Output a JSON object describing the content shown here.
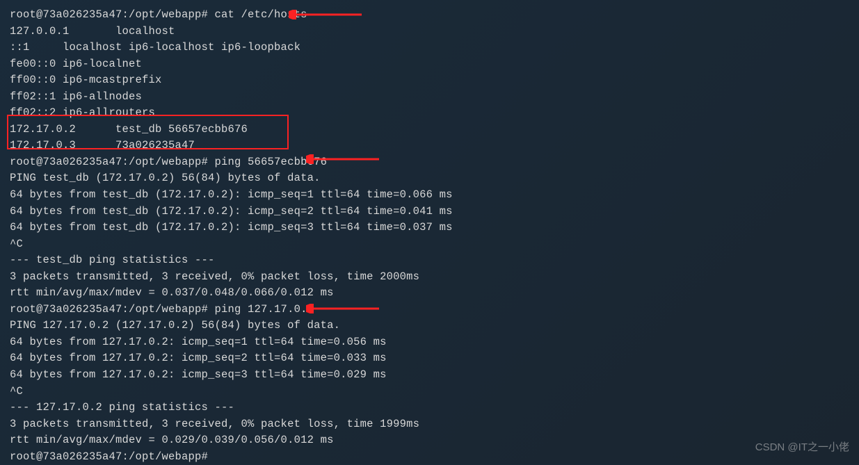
{
  "prompt1": "root@73a026235a47:/opt/webapp# cat /etc/hosts",
  "hosts": [
    "127.0.0.1       localhost",
    "::1     localhost ip6-localhost ip6-loopback",
    "fe00::0 ip6-localnet",
    "ff00::0 ip6-mcastprefix",
    "ff02::1 ip6-allnodes",
    "ff02::2 ip6-allrouters",
    "172.17.0.2      test_db 56657ecbb676",
    "172.17.0.3      73a026235a47"
  ],
  "prompt2": "root@73a026235a47:/opt/webapp# ping 56657ecbb676",
  "ping1": [
    "PING test_db (172.17.0.2) 56(84) bytes of data.",
    "64 bytes from test_db (172.17.0.2): icmp_seq=1 ttl=64 time=0.066 ms",
    "64 bytes from test_db (172.17.0.2): icmp_seq=2 ttl=64 time=0.041 ms",
    "64 bytes from test_db (172.17.0.2): icmp_seq=3 ttl=64 time=0.037 ms",
    "^C",
    "--- test_db ping statistics ---",
    "3 packets transmitted, 3 received, 0% packet loss, time 2000ms",
    "rtt min/avg/max/mdev = 0.037/0.048/0.066/0.012 ms"
  ],
  "prompt3": "root@73a026235a47:/opt/webapp# ping 127.17.0.2",
  "ping2": [
    "PING 127.17.0.2 (127.17.0.2) 56(84) bytes of data.",
    "64 bytes from 127.17.0.2: icmp_seq=1 ttl=64 time=0.056 ms",
    "64 bytes from 127.17.0.2: icmp_seq=2 ttl=64 time=0.033 ms",
    "64 bytes from 127.17.0.2: icmp_seq=3 ttl=64 time=0.029 ms",
    "^C",
    "--- 127.17.0.2 ping statistics ---",
    "3 packets transmitted, 3 received, 0% packet loss, time 1999ms",
    "rtt min/avg/max/mdev = 0.029/0.039/0.056/0.012 ms"
  ],
  "prompt4": "root@73a026235a47:/opt/webapp#",
  "watermark": "CSDN @IT之一小佬"
}
